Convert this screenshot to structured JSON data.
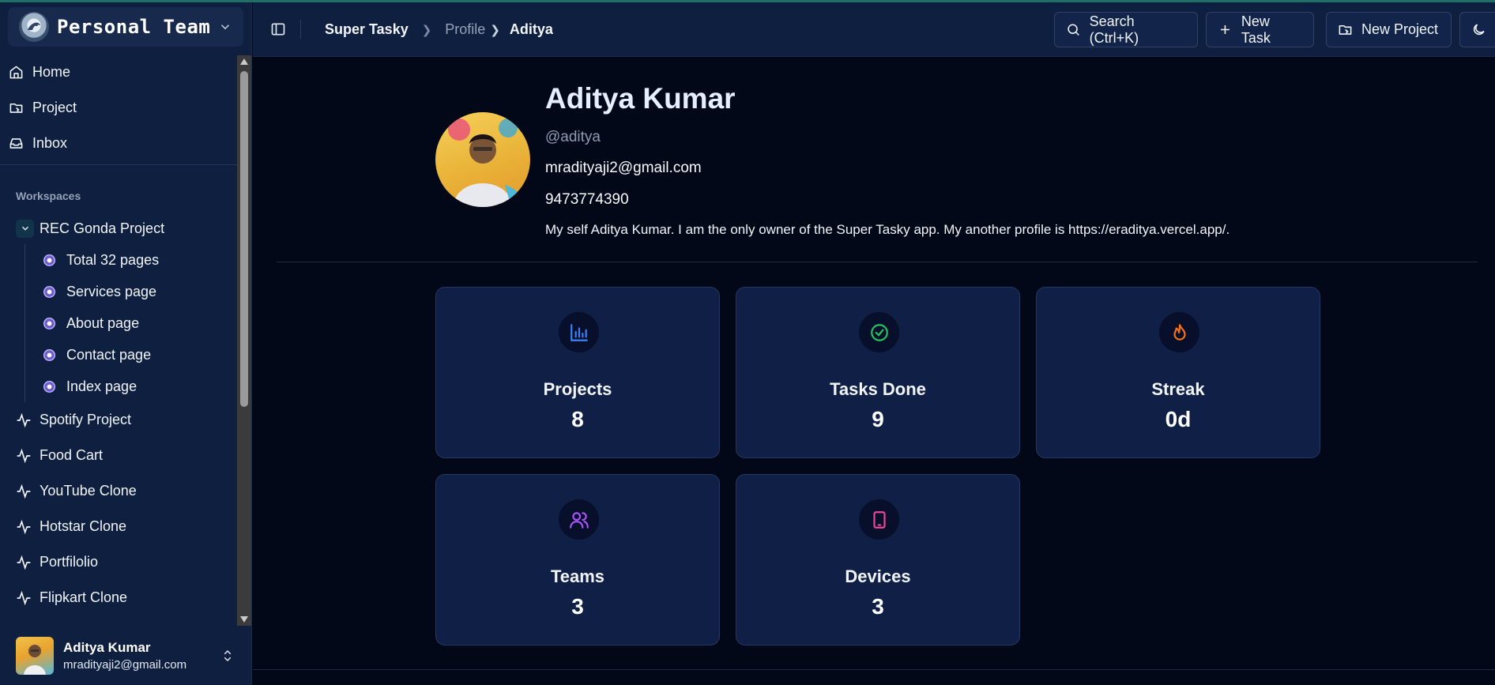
{
  "team": {
    "name": "Personal Team"
  },
  "nav": {
    "home": "Home",
    "project": "Project",
    "inbox": "Inbox"
  },
  "workspaces": {
    "label": "Workspaces",
    "expanded": {
      "name": "REC Gonda Project",
      "pages": [
        "Total 32 pages",
        "Services page",
        "About page",
        "Contact page",
        "Index page"
      ]
    },
    "others": [
      "Spotify Project",
      "Food Cart",
      "YouTube Clone",
      "Hotstar Clone",
      "Portfilolio",
      "Flipkart Clone"
    ]
  },
  "user": {
    "name": "Aditya Kumar",
    "email": "mradityaji2@gmail.com"
  },
  "header": {
    "breadcrumb": [
      "Super Tasky",
      "Profile",
      "Aditya"
    ],
    "search": "Search (Ctrl+K)",
    "new_task": "New Task",
    "new_project": "New Project"
  },
  "profile": {
    "name": "Aditya Kumar",
    "handle": "@aditya",
    "email": "mradityaji2@gmail.com",
    "phone": "9473774390",
    "bio": "My self Aditya Kumar. I am the only owner of the Super Tasky app. My another profile is https://eraditya.vercel.app/."
  },
  "stats": [
    {
      "label": "Projects",
      "value": "8",
      "icon": "bar-chart-icon",
      "color": "#3b82f6"
    },
    {
      "label": "Tasks Done",
      "value": "9",
      "icon": "check-circle-icon",
      "color": "#22c55e"
    },
    {
      "label": "Streak",
      "value": "0d",
      "icon": "flame-icon",
      "color": "#f97316"
    },
    {
      "label": "Teams",
      "value": "3",
      "icon": "users-icon",
      "color": "#a855f7"
    },
    {
      "label": "Devices",
      "value": "3",
      "icon": "tablet-icon",
      "color": "#ec4899"
    }
  ]
}
